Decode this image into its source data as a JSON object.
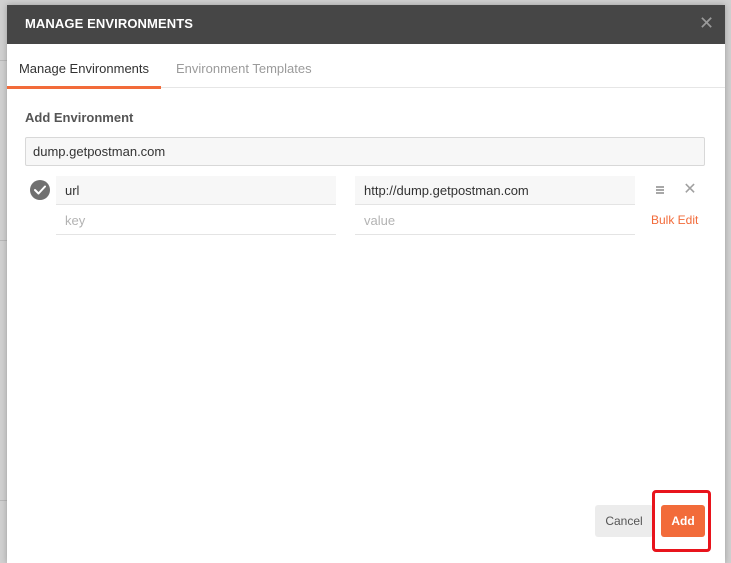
{
  "dialog": {
    "title": "MANAGE ENVIRONMENTS",
    "close_icon": "close-icon"
  },
  "tabs": [
    {
      "label": "Manage Environments",
      "active": true
    },
    {
      "label": "Environment Templates",
      "active": false
    }
  ],
  "form": {
    "section_label": "Add Environment",
    "environment_name": "dump.getpostman.com",
    "variables": [
      {
        "enabled": true,
        "key": "url",
        "value": "http://dump.getpostman.com"
      }
    ],
    "new_row": {
      "key_placeholder": "key",
      "value_placeholder": "value"
    },
    "bulk_edit_label": "Bulk Edit"
  },
  "footer": {
    "cancel_label": "Cancel",
    "add_label": "Add"
  },
  "colors": {
    "accent": "#f26b3a",
    "header_bg": "#464646",
    "highlight": "#e8141c"
  }
}
